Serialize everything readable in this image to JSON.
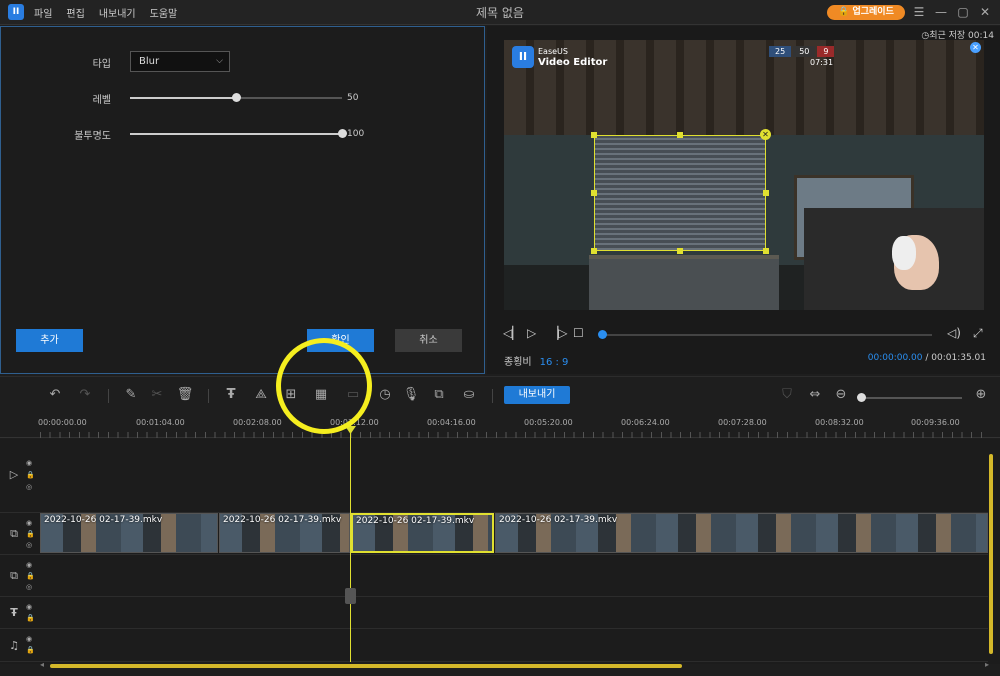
{
  "titlebar": {
    "title": "제목 없음",
    "menu": [
      "파일",
      "편집",
      "내보내기",
      "도움말"
    ],
    "upgrade_label": "업그레이드"
  },
  "properties": {
    "type_label": "타입",
    "type_value": "Blur",
    "level_label": "레벨",
    "level_value": "50",
    "level_fraction": 0.5,
    "opacity_label": "불투명도",
    "opacity_value": "100",
    "opacity_fraction": 1.0,
    "add_label": "추가",
    "ok_label": "확인",
    "cancel_label": "취소"
  },
  "preview": {
    "autosave": "최근 저장 00:14",
    "brand_line1": "EaseUS",
    "brand_line2": "Video Editor",
    "hud": [
      "25",
      "50",
      "9"
    ],
    "hud_time": "07:31",
    "hud_colors": [
      "#2f4f7a",
      "#333333",
      "#9a2a2a"
    ],
    "aspect_label": "종횡비",
    "aspect_value": "16 : 9",
    "current_time": "00:00:00.00",
    "total_time": "00:01:35.01",
    "progress_fraction": 0.0
  },
  "toolbar": {
    "export_label": "내보내기"
  },
  "ruler": {
    "labels": [
      "00:00:00.00",
      "00:01:04.00",
      "00:02:08.00",
      "00:03:12.00",
      "00:04:16.00",
      "00:05:20.00",
      "00:06:24.00",
      "00:07:28.00",
      "00:08:32.00",
      "00:09:36.00"
    ]
  },
  "timeline": {
    "clips": [
      "2022-10-26 02-17-39.mkv",
      "2022-10-26 02-17-39.mkv",
      "2022-10-26 02-17-39.mkv",
      "2022-10-26 02-17-39.mkv"
    ]
  },
  "colors": {
    "accent_blue": "#1f7ad6",
    "selection_yellow": "#e0e030",
    "upgrade_orange": "#f08a24"
  }
}
